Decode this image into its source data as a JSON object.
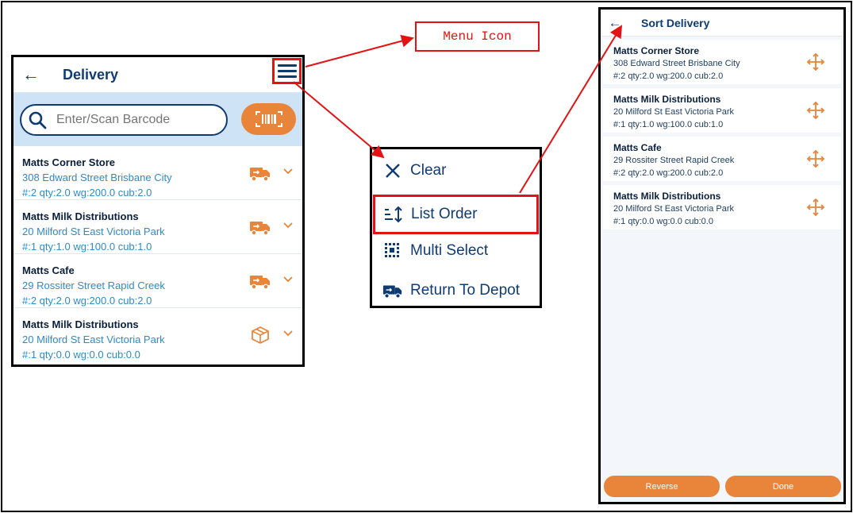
{
  "delivery_screen": {
    "title": "Delivery",
    "search_placeholder": "Enter/Scan Barcode",
    "items": [
      {
        "name": "Matts Corner Store",
        "address": "308 Edward Street Brisbane City",
        "meta": "#:2 qty:2.0 wg:200.0 cub:2.0",
        "status_icon": "truck-icon"
      },
      {
        "name": "Matts Milk Distributions",
        "address": "20 Milford St East Victoria Park",
        "meta": "#:1 qty:1.0 wg:100.0 cub:1.0",
        "status_icon": "truck-icon"
      },
      {
        "name": "Matts Cafe",
        "address": "29 Rossiter Street Rapid Creek",
        "meta": "#:2 qty:2.0 wg:200.0 cub:2.0",
        "status_icon": "truck-icon"
      },
      {
        "name": "Matts Milk Distributions",
        "address": "20 Milford St East Victoria Park",
        "meta": "#:1 qty:0.0 wg:0.0 cub:0.0",
        "status_icon": "package-icon"
      }
    ]
  },
  "callout": {
    "label": "Menu Icon"
  },
  "menu": {
    "items": [
      {
        "label": "Clear",
        "icon": "close-icon"
      },
      {
        "label": "List Order",
        "icon": "sort-icon",
        "highlighted": true
      },
      {
        "label": "Multi Select",
        "icon": "grid-select-icon"
      },
      {
        "label": "Return To Depot",
        "icon": "truck-icon"
      }
    ]
  },
  "sort_screen": {
    "title": "Sort Delivery",
    "items": [
      {
        "name": "Matts Corner Store",
        "address": "308 Edward Street Brisbane City",
        "meta": "#:2 qty:2.0 wg:200.0 cub:2.0"
      },
      {
        "name": "Matts Milk Distributions",
        "address": "20 Milford St East Victoria Park",
        "meta": "#:1 qty:1.0 wg:100.0 cub:1.0"
      },
      {
        "name": "Matts Cafe",
        "address": "29 Rossiter Street Rapid Creek",
        "meta": "#:2 qty:2.0 wg:200.0 cub:2.0"
      },
      {
        "name": "Matts Milk Distributions",
        "address": "20 Milford St East Victoria Park",
        "meta": "#:1 qty:0.0 wg:0.0 cub:0.0"
      }
    ],
    "reverse_label": "Reverse",
    "done_label": "Done"
  },
  "colors": {
    "primary": "#0f3b73",
    "accent": "#e8853a",
    "link": "#2f8ac7",
    "annotation": "#e31313",
    "search_band": "#cfe3f7"
  }
}
